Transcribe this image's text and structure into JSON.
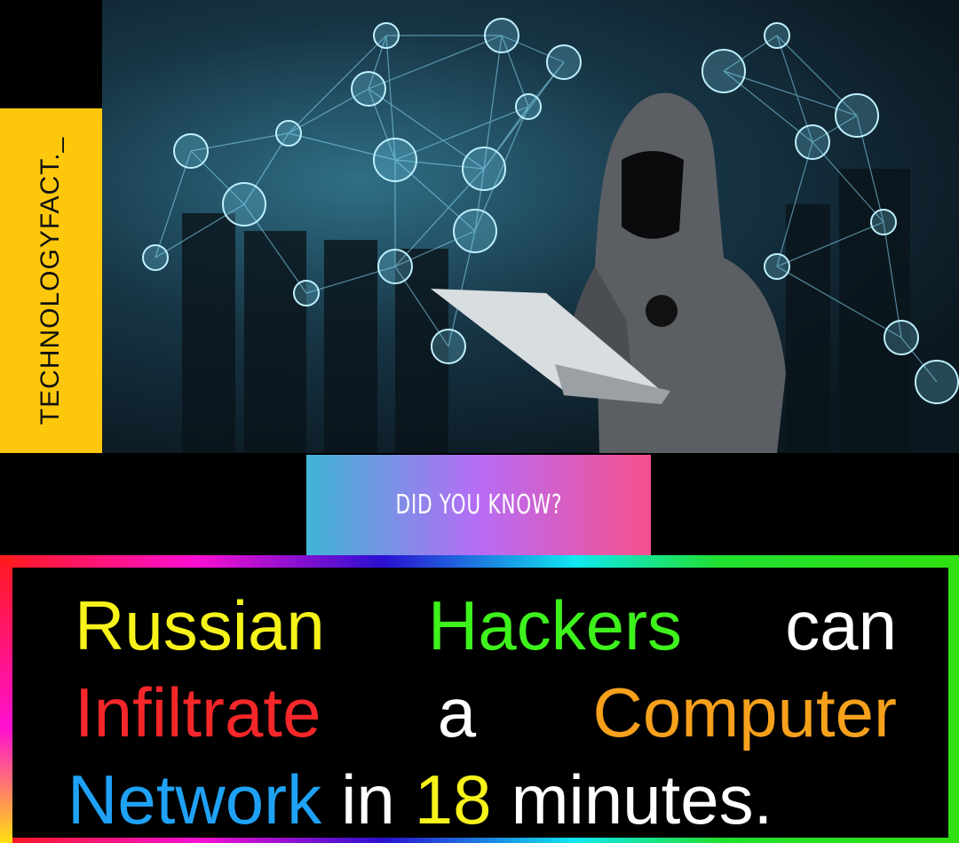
{
  "brand": {
    "handle": "TECHNOLOGYFACT._",
    "color": "#fdc80b"
  },
  "badge": {
    "label": "DID YOU KNOW?",
    "gradient": [
      "#3fb5d6",
      "#b66cf5",
      "#f7508f"
    ]
  },
  "headline": {
    "lines": [
      [
        {
          "text": "Russian",
          "color": "#f7f31a"
        },
        {
          "text": "Hackers",
          "color": "#3ef21c"
        },
        {
          "text": "can",
          "color": "#ffffff"
        }
      ],
      [
        {
          "text": "Infiltrate",
          "color": "#f5272a"
        },
        {
          "text": "a",
          "color": "#ffffff"
        },
        {
          "text": "Computer",
          "color": "#f6a01c"
        }
      ],
      [
        {
          "text": "Network",
          "color": "#1fa2f5"
        },
        {
          "text": "in",
          "color": "#ffffff"
        },
        {
          "text": "18",
          "color": "#f7f31a"
        },
        {
          "text": "minutes.",
          "color": "#ffffff"
        }
      ]
    ]
  },
  "photo": {
    "subject": "hooded-hacker-with-laptop"
  }
}
